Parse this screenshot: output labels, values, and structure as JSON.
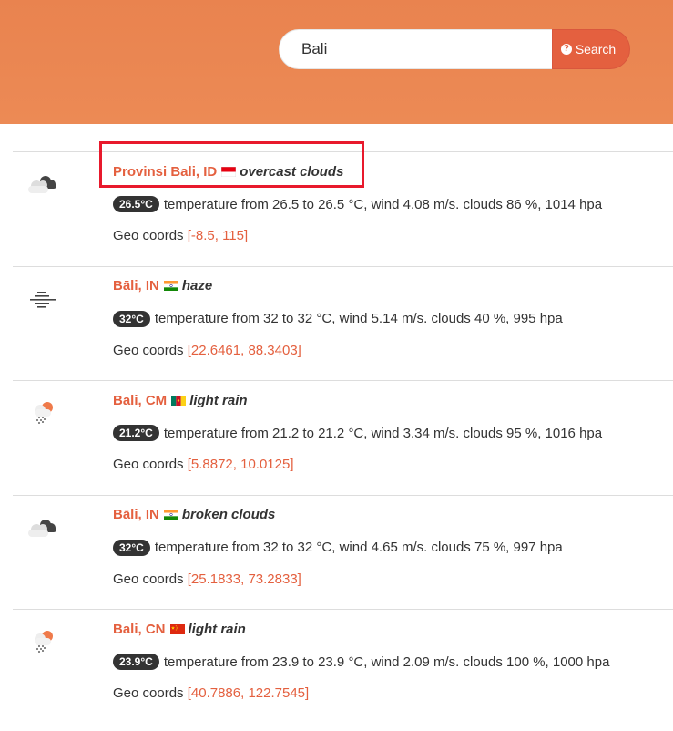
{
  "search": {
    "value": "Bali",
    "button_label": "Search"
  },
  "results": [
    {
      "city": "Provinsi Bali, ID",
      "country": "ID",
      "description": "overcast clouds",
      "icon": "overcast-clouds-icon",
      "temp_badge": "26.5°C",
      "details": "temperature from 26.5 to 26.5 °C, wind 4.08 m/s. clouds 86 %, 1014 hpa",
      "geo_label": "Geo coords",
      "geo_coords": "[-8.5, 115]"
    },
    {
      "city": "Bāli, IN",
      "country": "IN",
      "description": "haze",
      "icon": "haze-icon",
      "temp_badge": "32°C",
      "details": "temperature from 32 to 32 °C, wind 5.14 m/s. clouds 40 %, 995 hpa",
      "geo_label": "Geo coords",
      "geo_coords": "[22.6461, 88.3403]"
    },
    {
      "city": "Bali, CM",
      "country": "CM",
      "description": "light rain",
      "icon": "light-rain-icon",
      "temp_badge": "21.2°C",
      "details": "temperature from 21.2 to 21.2 °C, wind 3.34 m/s. clouds 95 %, 1016 hpa",
      "geo_label": "Geo coords",
      "geo_coords": "[5.8872, 10.0125]"
    },
    {
      "city": "Bāli, IN",
      "country": "IN",
      "description": "broken clouds",
      "icon": "broken-clouds-icon",
      "temp_badge": "32°C",
      "details": "temperature from 32 to 32 °C, wind 4.65 m/s. clouds 75 %, 997 hpa",
      "geo_label": "Geo coords",
      "geo_coords": "[25.1833, 73.2833]"
    },
    {
      "city": "Bali, CN",
      "country": "CN",
      "description": "light rain",
      "icon": "light-rain-icon",
      "temp_badge": "23.9°C",
      "details": "temperature from 23.9 to 23.9 °C, wind 2.09 m/s. clouds 100 %, 1000 hpa",
      "geo_label": "Geo coords",
      "geo_coords": "[40.7886, 122.7545]"
    }
  ],
  "colors": {
    "header": "#ec8a55",
    "accent": "#e4603f",
    "highlight": "#e8192c"
  }
}
